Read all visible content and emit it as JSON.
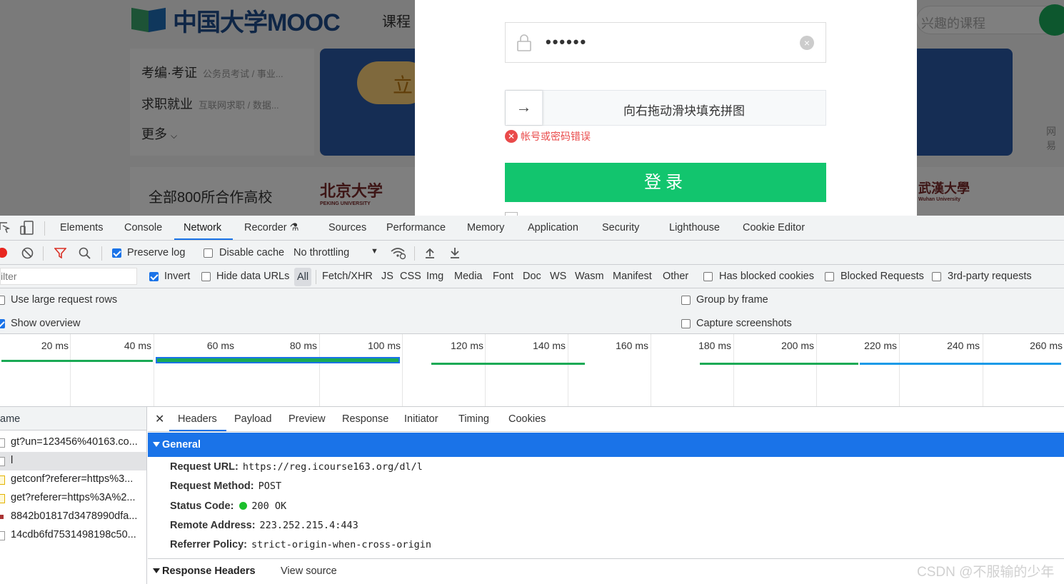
{
  "webpage": {
    "logo_text": "中国大学MOOC",
    "nav_course": "课程",
    "search_placeholder": "兴趣的课程",
    "categories": [
      {
        "title": "考编·考证",
        "sub": "公务员考试 / 事业..."
      },
      {
        "title": "求职就业",
        "sub": "互联网求职 / 数据..."
      },
      {
        "title": "更多",
        "sub": ""
      }
    ],
    "banner_btn": "立",
    "side_text": "网易",
    "partners_label": "全部800所合作高校",
    "uni1": "北京大学",
    "uni1_en": "PEKING UNIVERSITY",
    "uni2": "武漢大學",
    "uni2_en": "Wuhan University"
  },
  "login": {
    "password_value": "••••••",
    "slider_hint": "向右拖动滑块填充拼图",
    "slider_arrow": "→",
    "error_text": "帐号或密码错误",
    "login_button": "登录"
  },
  "devtools": {
    "tabs": [
      "Elements",
      "Console",
      "Network",
      "Recorder",
      "Sources",
      "Performance",
      "Memory",
      "Application",
      "Security",
      "Lighthouse",
      "Cookie Editor"
    ],
    "active_tab": "Network",
    "toolbar": {
      "preserve_log": "Preserve log",
      "disable_cache": "Disable cache",
      "throttling": "No throttling"
    },
    "filter": {
      "placeholder": "ilter",
      "invert": "Invert",
      "hide_data_urls": "Hide data URLs",
      "types": [
        "All",
        "Fetch/XHR",
        "JS",
        "CSS",
        "Img",
        "Media",
        "Font",
        "Doc",
        "WS",
        "Wasm",
        "Manifest",
        "Other"
      ],
      "has_blocked_cookies": "Has blocked cookies",
      "blocked_requests": "Blocked Requests",
      "third_party": "3rd-party requests"
    },
    "options": {
      "large_rows": "Use large request rows",
      "show_overview": "Show overview",
      "group_by_frame": "Group by frame",
      "capture_screenshots": "Capture screenshots"
    },
    "timeline_ticks": [
      "20 ms",
      "40 ms",
      "60 ms",
      "80 ms",
      "100 ms",
      "120 ms",
      "140 ms",
      "160 ms",
      "180 ms",
      "200 ms",
      "220 ms",
      "240 ms",
      "260 ms"
    ],
    "request_list": {
      "header": "ame",
      "rows": [
        {
          "name": "gt?un=123456%40163.co...",
          "type": "doc"
        },
        {
          "name": "l",
          "type": "doc"
        },
        {
          "name": "getconf?referer=https%3...",
          "type": "js"
        },
        {
          "name": "get?referer=https%3A%2...",
          "type": "js"
        },
        {
          "name": "8842b01817d3478990dfa...",
          "type": "img"
        },
        {
          "name": "14cdb6fd7531498198c50...",
          "type": "doc"
        }
      ]
    },
    "detail_tabs": [
      "Headers",
      "Payload",
      "Preview",
      "Response",
      "Initiator",
      "Timing",
      "Cookies"
    ],
    "general": {
      "title": "General",
      "request_url_label": "Request URL:",
      "request_url": "https://reg.icourse163.org/dl/l",
      "request_method_label": "Request Method:",
      "request_method": "POST",
      "status_code_label": "Status Code:",
      "status_code": "200 OK",
      "remote_address_label": "Remote Address:",
      "remote_address": "223.252.215.4:443",
      "referrer_policy_label": "Referrer Policy:",
      "referrer_policy": "strict-origin-when-cross-origin"
    },
    "response_headers": {
      "title": "Response Headers",
      "view_source": "View source"
    }
  },
  "watermark": "CSDN @不服输的少年"
}
